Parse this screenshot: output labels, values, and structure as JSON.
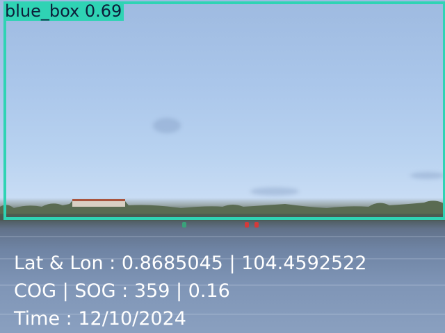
{
  "detection": {
    "label": "blue_box 0.69",
    "color": "#2fd3b4"
  },
  "telemetry": {
    "lat_lon": "Lat & Lon : 0.8685045 | 104.4592522",
    "cog_sog": "COG | SOG : 359 | 0.16",
    "time": "Time : 12/10/2024"
  }
}
